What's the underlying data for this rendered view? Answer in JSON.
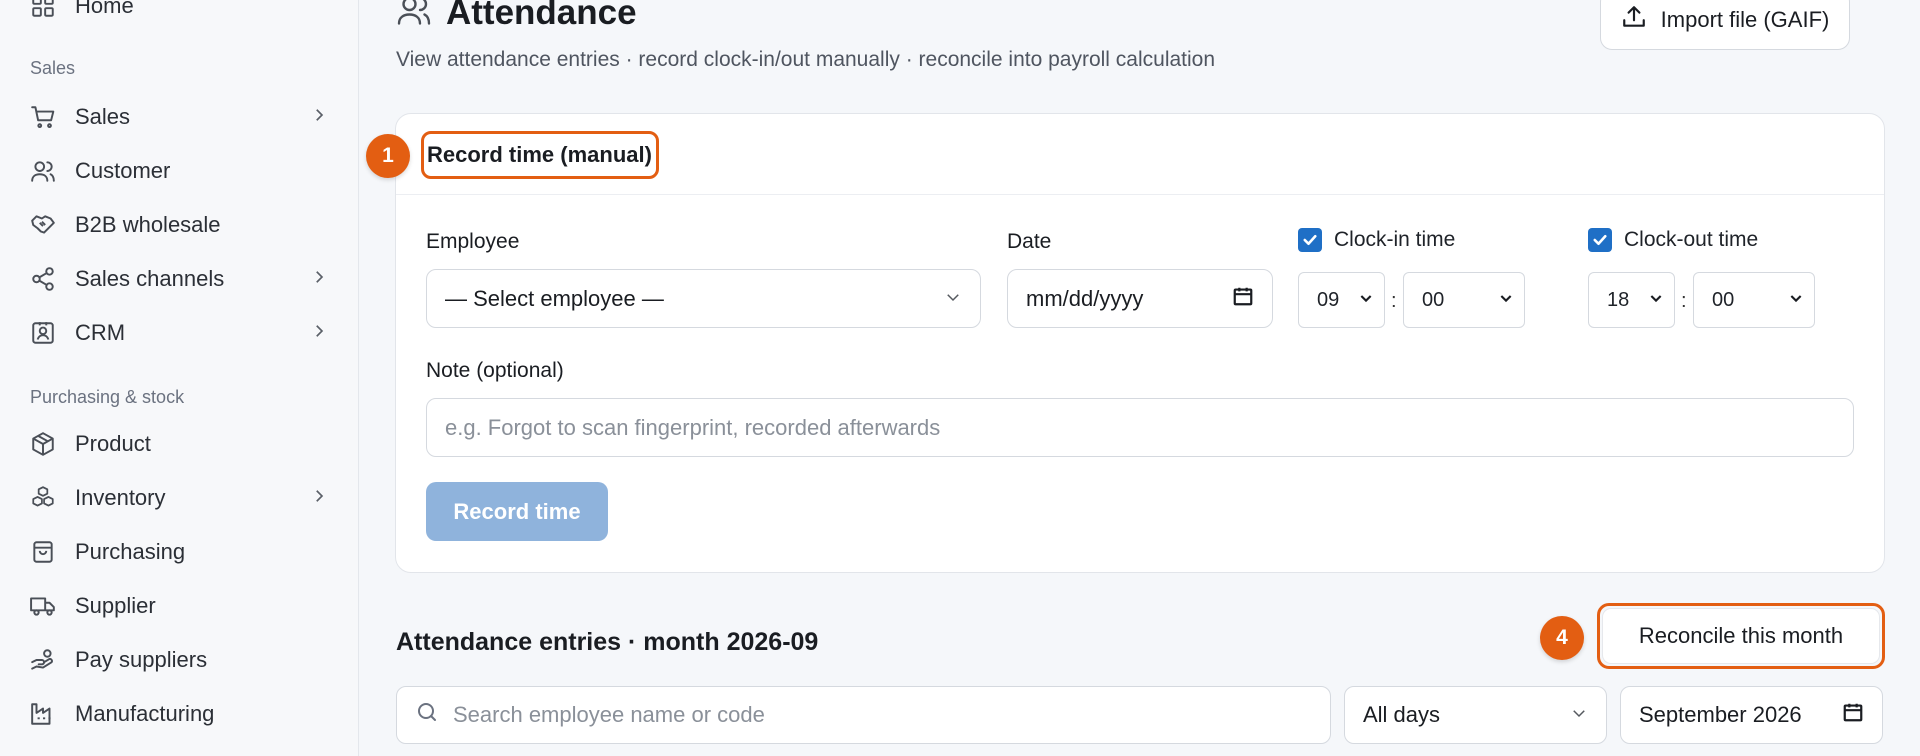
{
  "sidebar": {
    "home_label": "Home",
    "section_sales": "Sales",
    "section_purchasing": "Purchasing & stock",
    "items": [
      {
        "label": "Sales",
        "icon": "cart-icon"
      },
      {
        "label": "Customer",
        "icon": "users-icon"
      },
      {
        "label": "B2B wholesale",
        "icon": "handshake-icon"
      },
      {
        "label": "Sales channels",
        "icon": "share-icon"
      },
      {
        "label": "CRM",
        "icon": "contact-card-icon"
      },
      {
        "label": "Product",
        "icon": "box-icon"
      },
      {
        "label": "Inventory",
        "icon": "boxes-icon"
      },
      {
        "label": "Purchasing",
        "icon": "bag-icon"
      },
      {
        "label": "Supplier",
        "icon": "truck-icon"
      },
      {
        "label": "Pay suppliers",
        "icon": "hand-coins-icon"
      },
      {
        "label": "Manufacturing",
        "icon": "factory-icon"
      }
    ]
  },
  "header": {
    "title": "Attendance",
    "subtitle": "View attendance entries · record clock-in/out manually · reconcile into payroll calculation",
    "import_label": "Import file (GAIF)"
  },
  "record_card": {
    "title": "Record time (manual)",
    "step_badge": "1",
    "employee_label": "Employee",
    "employee_value": "— Select employee —",
    "date_label": "Date",
    "date_value": "mm/dd/yyyy",
    "clock_in_label": "Clock-in time",
    "clock_in_checked": true,
    "clock_in_hour": "09",
    "clock_in_minute": "00",
    "clock_out_label": "Clock-out time",
    "clock_out_checked": true,
    "clock_out_hour": "18",
    "clock_out_minute": "00",
    "colon": ":",
    "note_label": "Note (optional)",
    "note_placeholder": "e.g. Forgot to scan fingerprint, recorded afterwards",
    "submit_label": "Record time"
  },
  "entries": {
    "title": "Attendance entries · month 2026-09",
    "step_badge": "4",
    "reconcile_label": "Reconcile this month",
    "search_placeholder": "Search employee name or code",
    "filter_value": "All days",
    "month_value": "September 2026"
  },
  "colors": {
    "accent_orange": "#e35e12",
    "checkbox_blue": "#1f6fc6",
    "disabled_button": "#8fb3dc"
  }
}
